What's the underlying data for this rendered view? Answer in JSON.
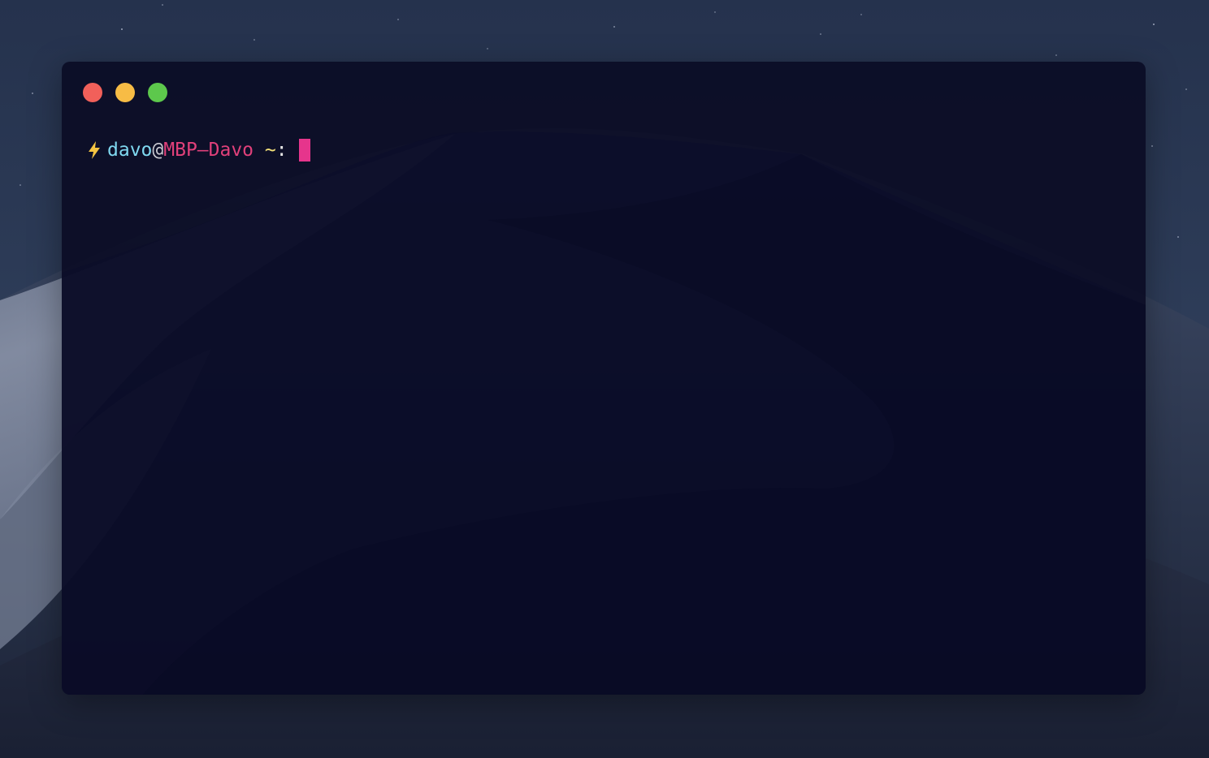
{
  "window": {
    "controls": {
      "close_color": "#f1605a",
      "minimize_color": "#f7bc45",
      "maximize_color": "#5dc84c"
    }
  },
  "prompt": {
    "icon": "lightning-bolt-icon",
    "icon_color": "#f5c542",
    "user": "davo",
    "at": "@",
    "host": "MBP–Davo",
    "path": " ~",
    "separator": ":",
    "colors": {
      "user": "#7fd8f0",
      "at": "#c8c8d0",
      "host": "#e0407a",
      "path": "#f5e27a",
      "separator": "#e6e6e6",
      "cursor": "#e6358c"
    }
  }
}
